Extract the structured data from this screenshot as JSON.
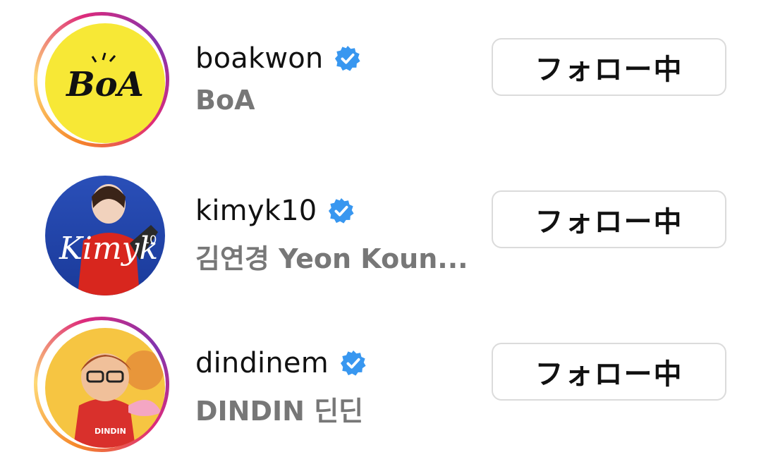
{
  "colors": {
    "verified_badge": "#3897f0",
    "story_ring_start": "#f58529",
    "story_ring_end": "#dd2a7b",
    "name_gray": "#777777",
    "button_border": "#dbdbdb"
  },
  "accounts": [
    {
      "username": "boakwon",
      "full_name": "BoA",
      "verified": true,
      "story_ring": true,
      "avatar_text": "BoA",
      "button_label": "フォロー中"
    },
    {
      "username": "kimyk10",
      "full_name": "김연경 Yeon Koun...",
      "verified": true,
      "story_ring": false,
      "avatar_text": "Kimyk",
      "avatar_number": "10",
      "button_label": "フォロー中"
    },
    {
      "username": "dindinem",
      "full_name": "DINDIN 딘딘",
      "verified": true,
      "story_ring": true,
      "avatar_text": "DINDIN",
      "button_label": "フォロー中"
    }
  ]
}
